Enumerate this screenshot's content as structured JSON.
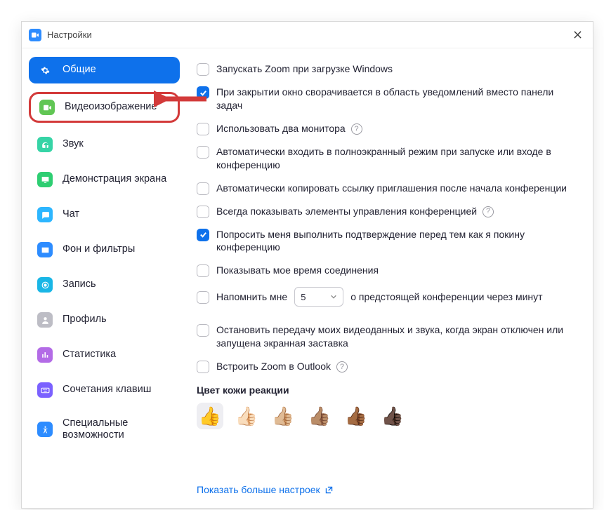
{
  "window": {
    "title": "Настройки"
  },
  "sidebar": {
    "items": [
      {
        "label": "Общие",
        "color": "#0E71EB"
      },
      {
        "label": "Видеоизображение",
        "color": "#61C654"
      },
      {
        "label": "Звук",
        "color": "#36D4A6"
      },
      {
        "label": "Демонстрация экрана",
        "color": "#2ECE72"
      },
      {
        "label": "Чат",
        "color": "#2DB6FF"
      },
      {
        "label": "Фон и фильтры",
        "color": "#2D8CFF"
      },
      {
        "label": "Запись",
        "color": "#19B6E6"
      },
      {
        "label": "Профиль",
        "color": "#BDBDC5"
      },
      {
        "label": "Статистика",
        "color": "#B36BE6"
      },
      {
        "label": "Сочетания клавиш",
        "color": "#7B61FF"
      },
      {
        "label": "Специальные возможности",
        "color": "#2D8CFF"
      }
    ]
  },
  "options": {
    "o1": {
      "label": "Запускать Zoom при загрузке Windows",
      "checked": false
    },
    "o2": {
      "label": "При закрытии окно сворачивается в область уведомлений вместо панели задач",
      "checked": true
    },
    "o3": {
      "label": "Использовать два монитора",
      "checked": false,
      "help": true
    },
    "o4": {
      "label": "Автоматически входить в полноэкранный режим при запуске или входе в конференцию",
      "checked": false
    },
    "o5": {
      "label": "Автоматически копировать ссылку приглашения после начала конференции",
      "checked": false
    },
    "o6": {
      "label": "Всегда показывать элементы управления конференцией",
      "checked": false,
      "help": true
    },
    "o7": {
      "label": "Попросить меня выполнить подтверждение перед тем как я покину конференцию",
      "checked": true
    },
    "o8": {
      "label": "Показывать мое время соединения",
      "checked": false
    },
    "o9": {
      "label_before": "Напомнить мне",
      "value": "5",
      "label_after": "о предстоящей конференции через минут",
      "checked": false
    },
    "o10": {
      "label": "Остановить передачу моих видеоданных и звука, когда экран отключен или запущена экранная заставка",
      "checked": false
    },
    "o11": {
      "label": "Встроить Zoom в Outlook",
      "checked": false,
      "help": true
    }
  },
  "skinTone": {
    "title": "Цвет кожи реакции",
    "tones": [
      "👍",
      "👍🏻",
      "👍🏼",
      "👍🏽",
      "👍🏾",
      "👍🏿"
    ],
    "selected": 0
  },
  "moreLink": "Показать больше настроек"
}
